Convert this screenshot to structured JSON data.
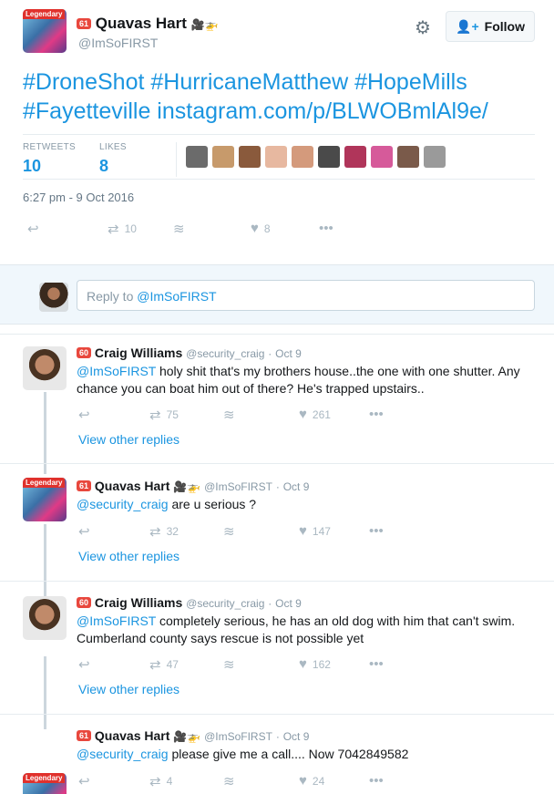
{
  "main_tweet": {
    "author_name": "Quavas Hart",
    "badge": "61",
    "avatar_label": "Legendary",
    "handle": "@ImSoFIRST",
    "name_emoji": "🎥🚁",
    "follow_label": "Follow",
    "text": "#DroneShot #HurricaneMatthew #HopeMills #Fayetteville instagram.com/p/BLWOBmlAl9e/",
    "retweets_label": "RETWEETS",
    "retweets": "10",
    "likes_label": "LIKES",
    "likes": "8",
    "timestamp": "6:27 pm - 9 Oct 2016",
    "actions": {
      "retweets": "10",
      "likes": "8"
    },
    "liker_colors": [
      "#6b6b6b",
      "#c79a6b",
      "#8a5a3c",
      "#e7b8a0",
      "#d49a7c",
      "#4a4a4a",
      "#b0355a",
      "#d65a9a",
      "#7a5a4a",
      "#9a9a9a"
    ]
  },
  "reply_composer": {
    "prefix": "Reply to ",
    "handle": "@ImSoFIRST"
  },
  "replies": [
    {
      "badge": "60",
      "name": "Craig Williams",
      "handle": "@security_craig",
      "date": "Oct 9",
      "mention": "@ImSoFIRST",
      "text": " holy shit that's my brothers house..the one with one shutter. Any chance you can boat him out of there? He's trapped upstairs..",
      "retweets": "75",
      "likes": "261",
      "view_other": "View other replies"
    },
    {
      "badge": "61",
      "name": "Quavas Hart",
      "emoji": "🎥🚁",
      "handle": "@ImSoFIRST",
      "date": "Oct 9",
      "mention": "@security_craig",
      "text": " are u serious ?",
      "retweets": "32",
      "likes": "147",
      "view_other": "View other replies"
    },
    {
      "badge": "60",
      "name": "Craig Williams",
      "handle": "@security_craig",
      "date": "Oct 9",
      "mention": "@ImSoFIRST",
      "text": " completely serious, he has an old dog with him that can't swim. Cumberland county says rescue is not possible yet",
      "retweets": "47",
      "likes": "162",
      "view_other": "View other replies"
    },
    {
      "badge": "61",
      "name": "Quavas Hart",
      "emoji": "🎥🚁",
      "handle": "@ImSoFIRST",
      "date": "Oct 9",
      "mention": "@security_craig",
      "text": " please give me a call.... Now 7042849582",
      "retweets": "4",
      "likes": "24"
    }
  ],
  "separator": "·"
}
